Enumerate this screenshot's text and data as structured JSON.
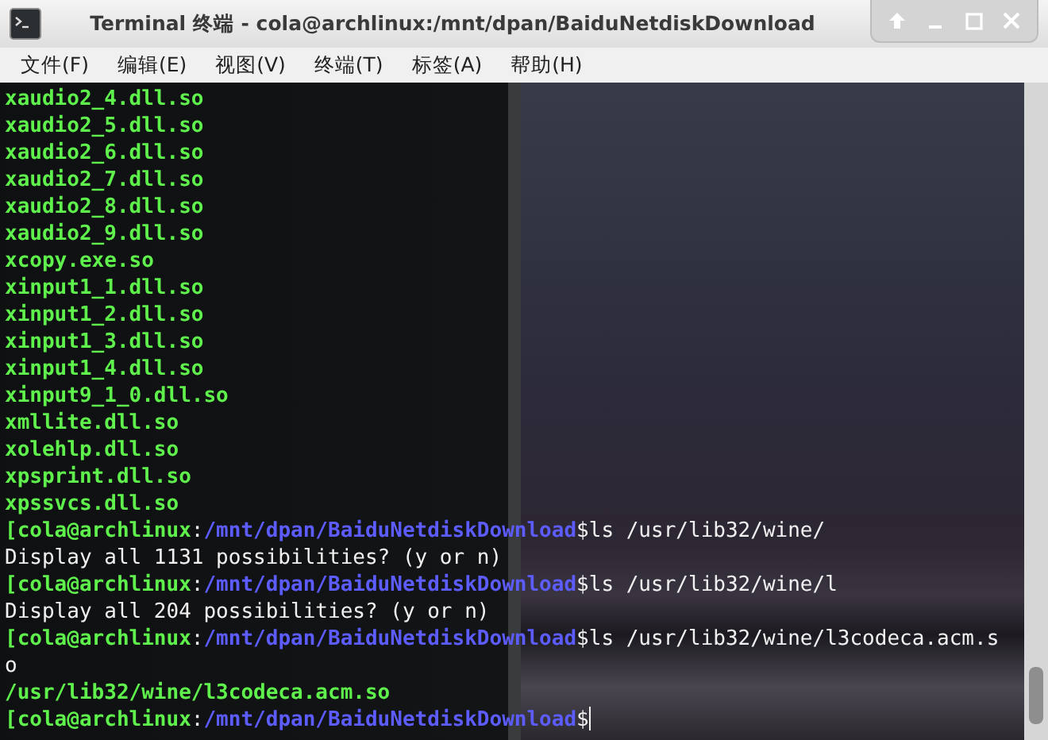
{
  "window": {
    "title": "Terminal 终端 - cola@archlinux:/mnt/dpan/BaiduNetdiskDownload"
  },
  "menu": [
    "文件(F)",
    "编辑(E)",
    "视图(V)",
    "终端(T)",
    "标签(A)",
    "帮助(H)"
  ],
  "lines": [
    {
      "kind": "match",
      "text": "xaudio2_4.dll.so"
    },
    {
      "kind": "match",
      "text": "xaudio2_5.dll.so"
    },
    {
      "kind": "match",
      "text": "xaudio2_6.dll.so"
    },
    {
      "kind": "match",
      "text": "xaudio2_7.dll.so"
    },
    {
      "kind": "match",
      "text": "xaudio2_8.dll.so"
    },
    {
      "kind": "match",
      "text": "xaudio2_9.dll.so"
    },
    {
      "kind": "match",
      "text": "xcopy.exe.so"
    },
    {
      "kind": "match",
      "text": "xinput1_1.dll.so"
    },
    {
      "kind": "match",
      "text": "xinput1_2.dll.so"
    },
    {
      "kind": "match",
      "text": "xinput1_3.dll.so"
    },
    {
      "kind": "match",
      "text": "xinput1_4.dll.so"
    },
    {
      "kind": "match",
      "text": "xinput9_1_0.dll.so"
    },
    {
      "kind": "match",
      "text": "xmllite.dll.so"
    },
    {
      "kind": "match",
      "text": "xolehlp.dll.so"
    },
    {
      "kind": "match",
      "text": "xpsprint.dll.so"
    },
    {
      "kind": "match",
      "text": "xpssvcs.dll.so"
    },
    {
      "kind": "prompt",
      "user": "[cola@archlinux",
      "sep": ":",
      "path": "/mnt/dpan/BaiduNetdiskDownload",
      "command": "$ls /usr/lib32/wine/",
      "cursor": false
    },
    {
      "kind": "text",
      "text": "Display all 1131 possibilities? (y or n)"
    },
    {
      "kind": "prompt",
      "user": "[cola@archlinux",
      "sep": ":",
      "path": "/mnt/dpan/BaiduNetdiskDownload",
      "command": "$ls /usr/lib32/wine/l",
      "cursor": false
    },
    {
      "kind": "text",
      "text": "Display all 204 possibilities? (y or n)"
    },
    {
      "kind": "prompt",
      "user": "[cola@archlinux",
      "sep": ":",
      "path": "/mnt/dpan/BaiduNetdiskDownload",
      "command": "$ls /usr/lib32/wine/l3codeca.acm.s",
      "cursor": false
    },
    {
      "kind": "text",
      "text": "o"
    },
    {
      "kind": "match",
      "text": "/usr/lib32/wine/l3codeca.acm.so"
    },
    {
      "kind": "prompt",
      "user": "[cola@archlinux",
      "sep": ":",
      "path": "/mnt/dpan/BaiduNetdiskDownload",
      "command": "$",
      "cursor": true
    }
  ]
}
